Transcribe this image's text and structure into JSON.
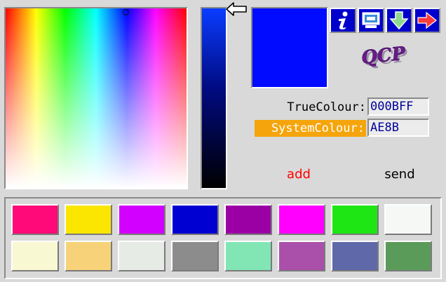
{
  "colors": {
    "accent": "#0000cc",
    "selected_color": "#000BFF",
    "system_label_bg": "#f5a50b",
    "field_text": "#00009a",
    "add_text": "#ff0000"
  },
  "toolbar": [
    {
      "name": "info-button",
      "icon": "info-icon"
    },
    {
      "name": "screen-button",
      "icon": "monitor-icon"
    },
    {
      "name": "download-button",
      "icon": "download-arrow-icon"
    },
    {
      "name": "forward-button",
      "icon": "right-arrow-icon"
    }
  ],
  "logo": {
    "text": "QCP"
  },
  "true_colour": {
    "label": "TrueColour:",
    "value": "000BFF"
  },
  "system_colour": {
    "label": "SystemColour:",
    "value": "AE8B"
  },
  "actions": {
    "add_label": "add",
    "send_label": "send"
  },
  "palette": {
    "rows": [
      [
        "#ff0a78",
        "#fae600",
        "#d200ff",
        "#0000d2",
        "#9b00a5",
        "#ff00ff",
        "#1ee614",
        "#f5f8f5"
      ],
      [
        "#f8f8d2",
        "#f8d278",
        "#e6ebe6",
        "#8c8c8c",
        "#82e6b4",
        "#aa50aa",
        "#5f69aa",
        "#5a9b5a"
      ]
    ]
  }
}
